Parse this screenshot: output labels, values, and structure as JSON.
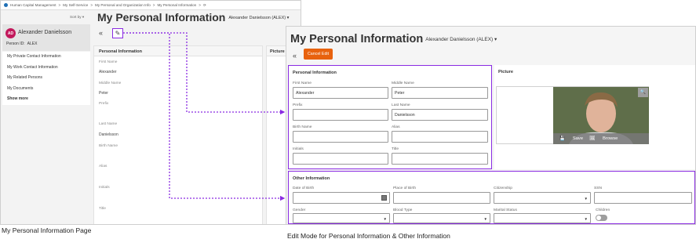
{
  "left_screen": {
    "breadcrumb": [
      "Human Capital Management",
      ">",
      "My Self-Service",
      ">",
      "My Personal and Organization Info",
      ">",
      "My Personal Information",
      ">"
    ],
    "sort_by": "Sort by",
    "profile": {
      "initials": "AD",
      "name": "Alexander Danielsson",
      "person_id_label": "Person ID:",
      "person_id": "ALEX"
    },
    "nav_items": [
      "My Private Contact Information",
      "My Work Contact Information",
      "My Related Persons",
      "My Documents"
    ],
    "show_more": "Show more",
    "page_title": "My Personal Information",
    "user_selector": "Alexander Danielsson (ALEX)",
    "panel_title": "Personal Information",
    "picture_title": "Picture",
    "fields": [
      {
        "label": "First Name",
        "value": "Alexander"
      },
      {
        "label": "Middle Name",
        "value": "Peter"
      },
      {
        "label": "Prefix",
        "value": ""
      },
      {
        "label": "Last Name",
        "value": "Danielsson"
      },
      {
        "label": "Birth Name",
        "value": ""
      },
      {
        "label": "Alias",
        "value": ""
      },
      {
        "label": "Initials",
        "value": ""
      },
      {
        "label": "Title",
        "value": ""
      }
    ]
  },
  "right_screen": {
    "page_title": "My Personal Information",
    "user_selector": "Alexander Danielsson (ALEX)",
    "cancel_edit": "Cancel Edit",
    "personal_info": {
      "title": "Personal Information",
      "first_name_label": "First Name",
      "first_name": "Alexander",
      "middle_name_label": "Middle Name",
      "middle_name": "Peter",
      "prefix_label": "Prefix",
      "prefix": "",
      "last_name_label": "Last Name",
      "last_name": "Danielsson",
      "birth_name_label": "Birth Name",
      "birth_name": "",
      "alias_label": "Alias",
      "alias": "",
      "initials_label": "Initials",
      "initials": "",
      "title_label": "Title",
      "title_value": ""
    },
    "picture": {
      "title": "Picture",
      "save": "Save",
      "browse": "Browse"
    },
    "other_info": {
      "title": "Other Information",
      "dob_label": "Date of Birth",
      "pob_label": "Place of Birth",
      "citizenship_label": "Citizenship",
      "ssn_label": "SSN",
      "gender_label": "Gender",
      "blood_type_label": "Blood Type",
      "marital_status_label": "Marital Status",
      "children_label": "Children"
    }
  },
  "captions": {
    "left": "My Personal Information Page",
    "right": "Edit Mode for Personal Information & Other Information"
  },
  "colors": {
    "accent": "#e8620e",
    "highlight": "#8a2be2",
    "avatar": "#c2185b"
  }
}
